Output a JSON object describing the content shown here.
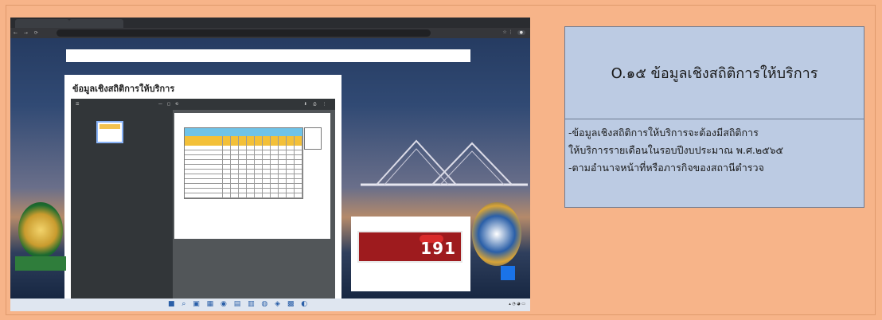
{
  "browser": {
    "tabs": [
      "",
      ""
    ],
    "url": ""
  },
  "site": {
    "search_placeholder": "",
    "page_title": "ข้อมูลเชิงสถิติการให้บริการ",
    "ad_number": "191",
    "ribbon_text": ""
  },
  "info_box": {
    "title": "O.๑๕ ข้อมูลเชิงสถิติการให้บริการ",
    "lines": [
      "-ข้อมูลเชิงสถิติการให้บริการจะต้องมีสถิติการ",
      "ให้บริการรายเดือนในรอบปีงบประมาณ พ.ศ.๒๕๖๕",
      "-ตามอำนาจหน้าที่หรือภารกิจของสถานีตำรวจ"
    ]
  },
  "colors": {
    "background": "#f7b489",
    "info_box": "#bccbe3",
    "ad": "#9e1b1e"
  }
}
